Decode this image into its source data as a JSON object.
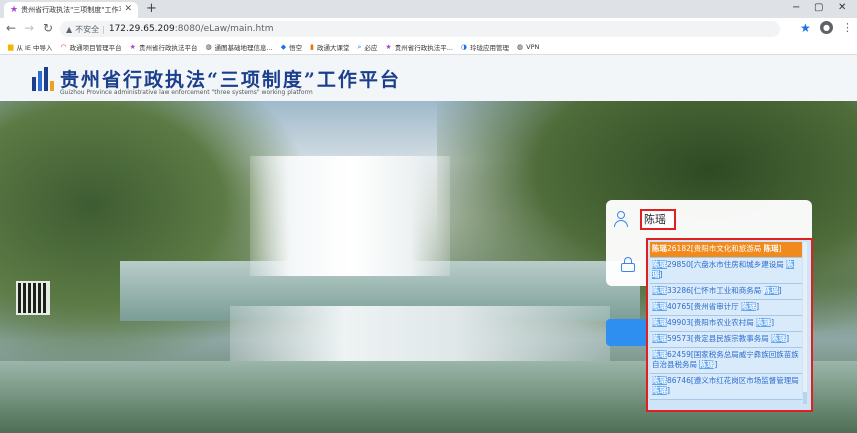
{
  "browser": {
    "tab_title": "贵州省行政执法\"三项制度\"工作平",
    "new_tab": "+",
    "window_controls": [
      "−",
      "▢",
      "✕"
    ],
    "security_label": "不安全",
    "url_host": "172.29.65.209",
    "url_rest": ":8080/eLaw/main.htm",
    "bookmarks": [
      {
        "label": "从 IE 中导入",
        "icon": "folder-icon",
        "color": "#f4b400"
      },
      {
        "label": "政通项目管理平台",
        "icon": "ring-icon",
        "color": "#d93025"
      },
      {
        "label": "贵州省行政执法平台",
        "icon": "star-icon",
        "color": "#a64ac9"
      },
      {
        "label": "通图基础地理信息...",
        "icon": "globe-icon",
        "color": "#333333"
      },
      {
        "label": "悟空",
        "icon": "shield-icon",
        "color": "#1a73e8"
      },
      {
        "label": "政通大课堂",
        "icon": "book-icon",
        "color": "#e8710a"
      },
      {
        "label": "必应",
        "icon": "search-icon",
        "color": "#1a73e8"
      },
      {
        "label": "贵州省行政执法平...",
        "icon": "star-icon",
        "color": "#a64ac9"
      },
      {
        "label": "玲珑应用管理",
        "icon": "app-icon",
        "color": "#1a73e8"
      },
      {
        "label": "VPN",
        "icon": "globe-icon",
        "color": "#333333"
      }
    ]
  },
  "header": {
    "title_cn": "贵州省行政执法“三项制度”工作平台",
    "title_en": "Guizhou Province administrative law enforcement \"three systems\" working platform"
  },
  "login": {
    "username_value": "陈瑶"
  },
  "suggestions": [
    {
      "name": "陈瑶",
      "text": "26182[贵阳市文化和旅游局 ",
      "suffix": "]",
      "active": true
    },
    {
      "name": "陈瑶",
      "text": "29850[六盘水市住房和城乡建设局 ",
      "suffix": "]",
      "active": false
    },
    {
      "name": "陈瑶",
      "text": "33286[仁怀市工业和商务局 ",
      "suffix": "]",
      "active": false
    },
    {
      "name": "陈瑶",
      "text": "40765[贵州省审计厅 ",
      "suffix": "]",
      "active": false
    },
    {
      "name": "陈瑶",
      "text": "49903[贵阳市农业农村局 ",
      "suffix": "]",
      "active": false
    },
    {
      "name": "陈瑶",
      "text": "59573[贵定县民族宗教事务局 ",
      "suffix": "]",
      "active": false
    },
    {
      "name": "陈瑶",
      "text": "62459[国家税务总局威宁彝族回族苗族自治县税务局 ",
      "suffix": "]",
      "active": false
    },
    {
      "name": "陈瑶",
      "text": "86746[遵义市红花岗区市场监督管理局 ",
      "suffix": "]",
      "active": false
    }
  ],
  "colors": {
    "accent": "#2f8ff0",
    "highlight": "#f08a1c",
    "annotation_red": "#e02020"
  }
}
